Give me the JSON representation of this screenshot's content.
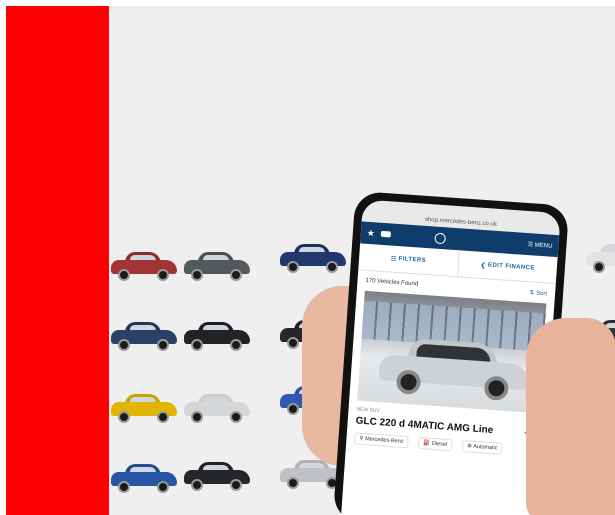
{
  "phone": {
    "url": "shop.mercedes-benz.co.uk",
    "filters_label": "FILTERS",
    "finance_label": "EDIT FINANCE",
    "menu_label": "MENU",
    "vehicles_found": "170 Vehicles Found",
    "sort_label": "Sort",
    "listing": {
      "tag": "NEW SUV",
      "model": "GLC 220 d 4MATIC AMG Line",
      "chips": [
        "Mercedes-Benz",
        "Diesel",
        "Automatic"
      ]
    }
  },
  "colors": {
    "accent_red": "#ff0000",
    "app_blue": "#0f3d6b",
    "link_blue": "#1a7fc1",
    "background": "#efefef"
  },
  "icons": [
    "star-icon",
    "location-icon",
    "fuel-icon",
    "gearbox-icon",
    "sort-icon",
    "filter-icon",
    "menu-icon"
  ]
}
